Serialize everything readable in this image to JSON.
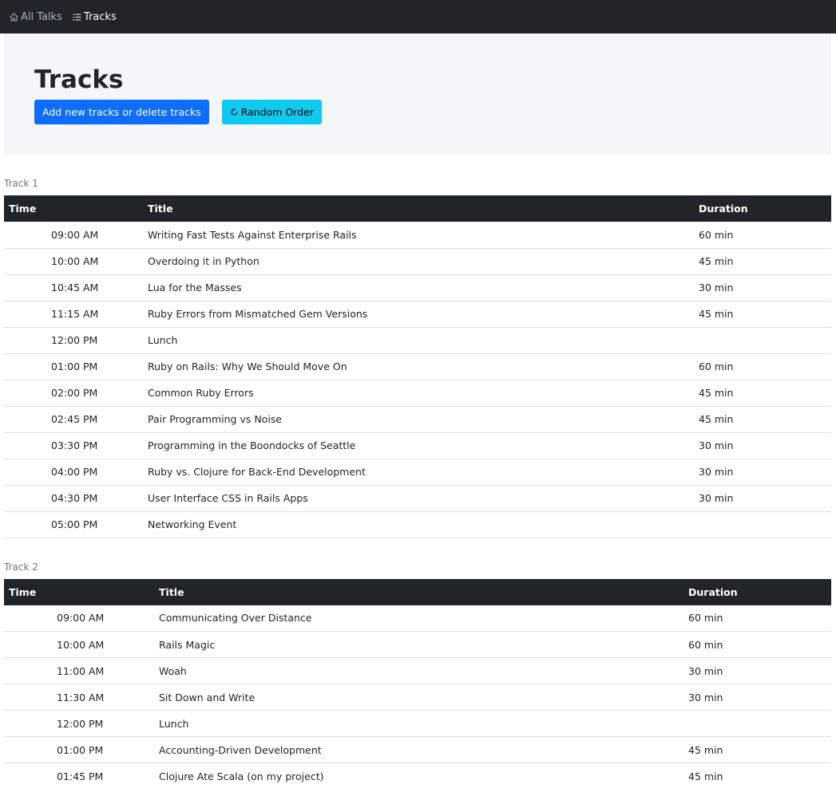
{
  "nav": {
    "all_talks_label": "All Talks",
    "tracks_label": "Tracks"
  },
  "hero": {
    "title": "Tracks",
    "add_button_label": "Add new tracks or delete tracks",
    "random_button_label": "Random Order"
  },
  "columns": {
    "time": "Time",
    "title": "Title",
    "duration": "Duration"
  },
  "tracks": [
    {
      "name": "Track 1",
      "rows": [
        {
          "time": "09:00 AM",
          "title": "Writing Fast Tests Against Enterprise Rails",
          "duration": "60 min"
        },
        {
          "time": "10:00 AM",
          "title": "Overdoing it in Python",
          "duration": "45 min"
        },
        {
          "time": "10:45 AM",
          "title": "Lua for the Masses",
          "duration": "30 min"
        },
        {
          "time": "11:15 AM",
          "title": "Ruby Errors from Mismatched Gem Versions",
          "duration": "45 min"
        },
        {
          "time": "12:00 PM",
          "title": "Lunch",
          "duration": ""
        },
        {
          "time": "01:00 PM",
          "title": "Ruby on Rails: Why We Should Move On",
          "duration": "60 min"
        },
        {
          "time": "02:00 PM",
          "title": "Common Ruby Errors",
          "duration": "45 min"
        },
        {
          "time": "02:45 PM",
          "title": "Pair Programming vs Noise",
          "duration": "45 min"
        },
        {
          "time": "03:30 PM",
          "title": "Programming in the Boondocks of Seattle",
          "duration": "30 min"
        },
        {
          "time": "04:00 PM",
          "title": "Ruby vs. Clojure for Back-End Development",
          "duration": "30 min"
        },
        {
          "time": "04:30 PM",
          "title": "User Interface CSS in Rails Apps",
          "duration": "30 min"
        },
        {
          "time": "05:00 PM",
          "title": "Networking Event",
          "duration": ""
        }
      ]
    },
    {
      "name": "Track 2",
      "rows": [
        {
          "time": "09:00 AM",
          "title": "Communicating Over Distance",
          "duration": "60 min"
        },
        {
          "time": "10:00 AM",
          "title": "Rails Magic",
          "duration": "60 min"
        },
        {
          "time": "11:00 AM",
          "title": "Woah",
          "duration": "30 min"
        },
        {
          "time": "11:30 AM",
          "title": "Sit Down and Write",
          "duration": "30 min"
        },
        {
          "time": "12:00 PM",
          "title": "Lunch",
          "duration": ""
        },
        {
          "time": "01:00 PM",
          "title": "Accounting-Driven Development",
          "duration": "45 min"
        },
        {
          "time": "01:45 PM",
          "title": "Clojure Ate Scala (on my project)",
          "duration": "45 min"
        }
      ]
    }
  ]
}
